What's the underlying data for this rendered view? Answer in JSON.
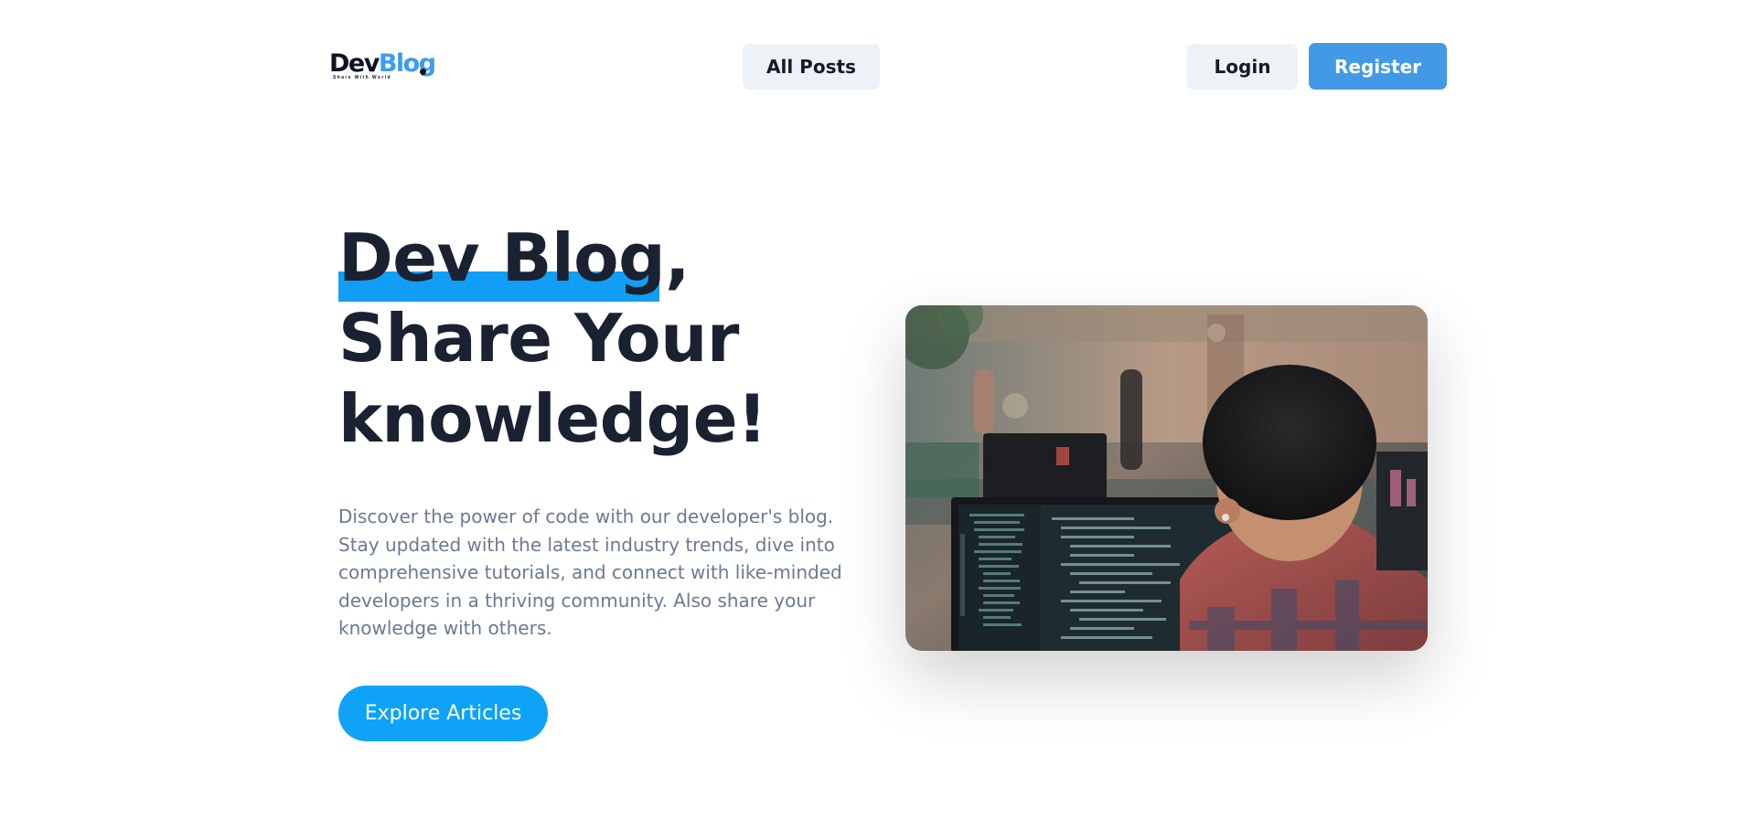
{
  "header": {
    "logo": {
      "dev": "Dev",
      "blog": "Blog",
      "tagline": "Share With World"
    },
    "nav": {
      "all_posts_label": "All Posts"
    },
    "auth": {
      "login_label": "Login",
      "register_label": "Register"
    }
  },
  "hero": {
    "title_line1": "Dev Blog,",
    "title_line2": "Share Your",
    "title_line3": "knowledge!",
    "description": "Discover the power of code with our developer's blog. Stay updated with the latest industry trends, dive into comprehensive tutorials, and connect with like-minded developers in a thriving community. Also share your knowledge with others.",
    "cta_label": "Explore Articles",
    "image_icon": "developer-at-monitor-photo"
  },
  "colors": {
    "accent_blue": "#129ef6",
    "register_blue": "#4399e6",
    "nav_bg": "#edf2f7",
    "heading": "#1a2130",
    "body_text": "#6b7a90"
  }
}
